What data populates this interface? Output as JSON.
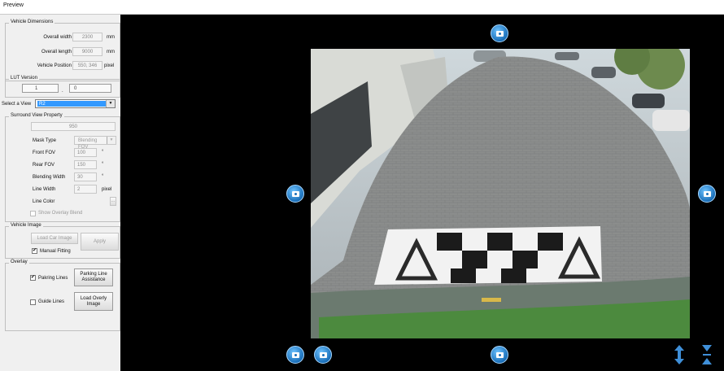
{
  "window": {
    "title": "Preview"
  },
  "vehicle_dimensions": {
    "title": "Vehicle Dimensions",
    "overall_width": {
      "label": "Overall width",
      "value": "2300",
      "unit": "mm"
    },
    "overall_length": {
      "label": "Overall length",
      "value": "9000",
      "unit": "mm"
    },
    "vehicle_position": {
      "label": "Vehicle Position",
      "value": "550, 346",
      "unit": "pixel"
    }
  },
  "lut_version": {
    "title": "LUT Version",
    "major": "1",
    "separator": ".",
    "minor": "0"
  },
  "view_select": {
    "label": "Select a View",
    "value": "R2"
  },
  "surround_view": {
    "title": "Surround View Property",
    "top_value": "950",
    "mask_type": {
      "label": "Mask Type",
      "value": "Blending FOV"
    },
    "front_fov": {
      "label": "Front FOV",
      "value": "100",
      "unit": "°"
    },
    "rear_fov": {
      "label": "Rear FOV",
      "value": "150",
      "unit": "°"
    },
    "blending_width": {
      "label": "Blending Width",
      "value": "30",
      "unit": "°"
    },
    "line_width": {
      "label": "Line Width",
      "value": "2",
      "unit": "pixel"
    },
    "line_color": {
      "label": "Line Color",
      "button": "..."
    },
    "show_overlay_blend": {
      "label": "Show Overlay Blend",
      "checked": false
    }
  },
  "vehicle_image": {
    "title": "Vehicle Image",
    "load_car_image": "Load Car Image",
    "apply": "Apply",
    "manual_fitting": {
      "label": "Manual Fitting",
      "checked": true
    }
  },
  "overlay": {
    "title": "Overlay",
    "parking_lines": {
      "label": "Pakring Lines",
      "checked": true
    },
    "parking_line_assistance_1": "Parking Line",
    "parking_line_assistance_2": "Assistance",
    "guide_lines": {
      "label": "Guide Lines",
      "checked": false
    },
    "load_overly_image_1": "Load Overly",
    "load_overly_image_2": "Image"
  },
  "check_mark": "✔",
  "icons": {
    "camera_top": "camera-top-icon",
    "camera_left": "camera-left-icon",
    "camera_right": "camera-right-icon",
    "camera_bottom": "camera-bottom-icon",
    "rotate_left": "rotate-left-camera-icon",
    "rotate_right": "rotate-right-camera-icon",
    "expand_vertical": "expand-vertical-icon",
    "collapse_vertical": "collapse-vertical-icon"
  },
  "colors": {
    "accent": "#3399ff",
    "icon_blue": "#1a6fb9",
    "title_bar": "#1b4f86"
  }
}
